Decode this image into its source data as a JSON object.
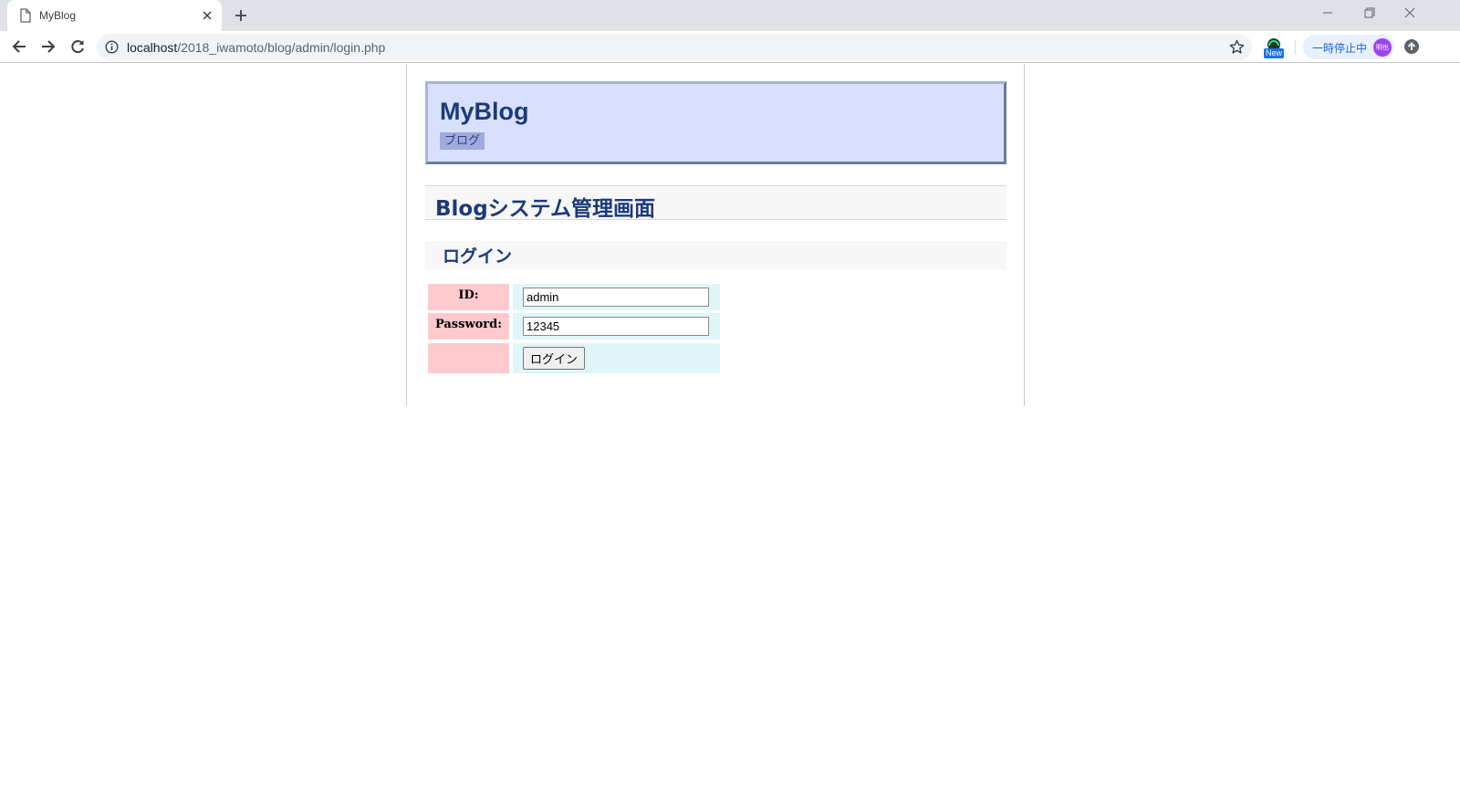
{
  "browser": {
    "tab_title": "MyBlog",
    "url_host": "localhost",
    "url_path": "/2018_iwamoto/blog/admin/login.php",
    "extension_badge": "New",
    "profile_status": "一時停止中",
    "profile_initials": "明也"
  },
  "site": {
    "title": "MyBlog",
    "nav_link": "ブログ"
  },
  "admin": {
    "heading": "Blogシステム管理画面"
  },
  "login": {
    "heading": "ログイン",
    "id_label": "ID:",
    "id_value": "admin",
    "password_label": "Password:",
    "password_value": "12345",
    "submit_label": "ログイン"
  },
  "colors": {
    "header_bg": "#d8e0fd",
    "heading_text": "#1c3a7a",
    "label_cell": "#ffc9cd",
    "value_cell": "#dff5fa"
  }
}
